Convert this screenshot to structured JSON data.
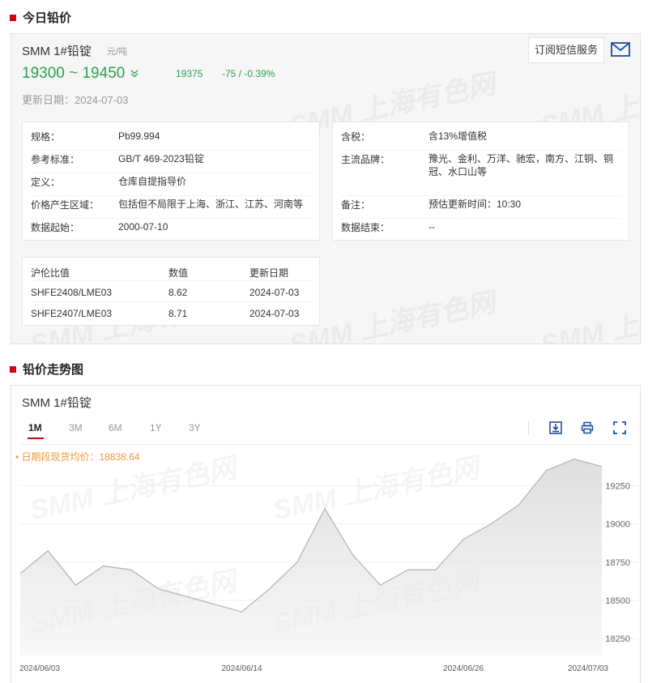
{
  "section1": {
    "title": "今日铅价"
  },
  "product": {
    "name": "SMM 1#铅锭",
    "unit": "元/吨",
    "price_range": "19300 ~ 19450",
    "trend_icon": "double-chevron-down-icon",
    "avg": "19375",
    "change": "-75 / -0.39%",
    "update": "更新日期：2024-07-03",
    "sms_label": "订阅短信服务",
    "color_down": "#2d9f4b"
  },
  "watermark": "SMM 上海有色网",
  "specs_left": [
    {
      "k": "规格：",
      "v": "Pb99.994"
    },
    {
      "k": "参考标准：",
      "v": "GB/T 469-2023铅锭"
    },
    {
      "k": "定义：",
      "v": "仓库自提指导价"
    },
    {
      "k": "价格产生区域：",
      "v": "包括但不局限于上海、浙江、江苏、河南等"
    },
    {
      "k": "数据起始：",
      "v": "2000-07-10"
    }
  ],
  "specs_right": [
    {
      "k": "含税：",
      "v": "含13%增值税"
    },
    {
      "k": "主流品牌：",
      "v": "豫光、金利、万洋、驰宏，南方、江铜、铜冠、水口山等"
    },
    {
      "k": "备注：",
      "v": "预估更新时间：10:30"
    },
    {
      "k": "数据结束：",
      "v": "--"
    }
  ],
  "ratio_table": {
    "headers": [
      "沪伦比值",
      "数值",
      "更新日期"
    ],
    "rows": [
      [
        "SHFE2408/LME03",
        "8.62",
        "2024-07-03"
      ],
      [
        "SHFE2407/LME03",
        "8.71",
        "2024-07-03"
      ]
    ]
  },
  "section2": {
    "title": "铅价走势图"
  },
  "chart_panel": {
    "title": "SMM 1#铅锭",
    "tabs": [
      "1M",
      "3M",
      "6M",
      "1Y",
      "3Y"
    ],
    "active_tab": "1M",
    "tools": [
      "download-icon",
      "print-icon",
      "fullscreen-icon"
    ],
    "avg_label": "• 日期段现货均价：18838.64"
  },
  "chart_data": {
    "type": "area",
    "x": [
      "2024-06-03",
      "2024-06-04",
      "2024-06-05",
      "2024-06-06",
      "2024-06-07",
      "2024-06-11",
      "2024-06-12",
      "2024-06-13",
      "2024-06-14",
      "2024-06-17",
      "2024-06-18",
      "2024-06-19",
      "2024-06-20",
      "2024-06-21",
      "2024-06-24",
      "2024-06-25",
      "2024-06-26",
      "2024-06-27",
      "2024-06-28",
      "2024-07-01",
      "2024-07-02",
      "2024-07-03"
    ],
    "values": [
      18675,
      18825,
      18600,
      18725,
      18700,
      18575,
      18525,
      18475,
      18425,
      18575,
      18750,
      19100,
      18800,
      18600,
      18700,
      18700,
      18900,
      19000,
      19125,
      19350,
      19425,
      19375
    ],
    "x_tick_labels": [
      {
        "index": 0,
        "label": "2024/06/03"
      },
      {
        "index": 8,
        "label": "2024/06/14"
      },
      {
        "index": 16,
        "label": "2024/06/26"
      },
      {
        "index": 21,
        "label": "2024/07/03"
      }
    ],
    "y_ticks": [
      18250,
      18500,
      18750,
      19000,
      19250
    ],
    "ylim": [
      18140,
      19470
    ],
    "line_color": "#b5b5b5",
    "grid": "horizontal"
  }
}
